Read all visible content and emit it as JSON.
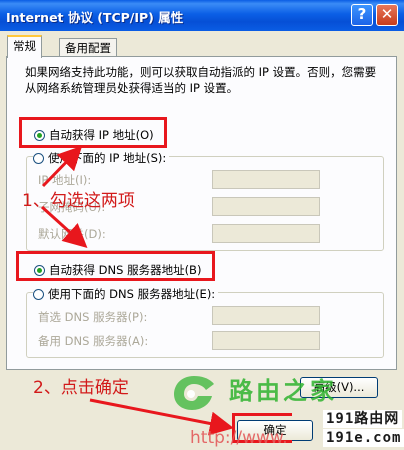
{
  "window": {
    "title": "Internet 协议 (TCP/IP) 属性",
    "help_label": "?",
    "close_label": "✕"
  },
  "tabs": [
    {
      "label": "常规"
    },
    {
      "label": "备用配置"
    }
  ],
  "description": "如果网络支持此功能，则可以获取自动指派的 IP 设置。否则，您需要从网络系统管理员处获得适当的 IP 设置。",
  "ip_section": {
    "auto_label": "自动获得 IP 地址(O)",
    "manual_label": "使用下面的 IP 地址(S):",
    "auto_selected": true,
    "fields": [
      {
        "label": "IP 地址(I):"
      },
      {
        "label": "子网掩码(U):"
      },
      {
        "label": "默认网关(D):"
      }
    ]
  },
  "dns_section": {
    "auto_label": "自动获得 DNS 服务器地址(B)",
    "manual_label": "使用下面的 DNS 服务器地址(E):",
    "auto_selected": true,
    "fields": [
      {
        "label": "首选 DNS 服务器(P):"
      },
      {
        "label": "备用 DNS 服务器(A):"
      }
    ]
  },
  "buttons": {
    "advanced_label": "高级(V)...",
    "ok_label": "确定"
  },
  "annotations": {
    "step1": "1、勾选这两项",
    "step2": "2、点击确定"
  },
  "watermarks": {
    "logo_text": "路由之家",
    "url_text": "http://www.",
    "site_line1": "191路由网",
    "site_line2": "191e.com"
  },
  "colors": {
    "titlebar": "#0a5de4",
    "annotation_red": "#e8171d",
    "radio_dot": "#21a121",
    "watermark_green": "#2fb32f"
  }
}
